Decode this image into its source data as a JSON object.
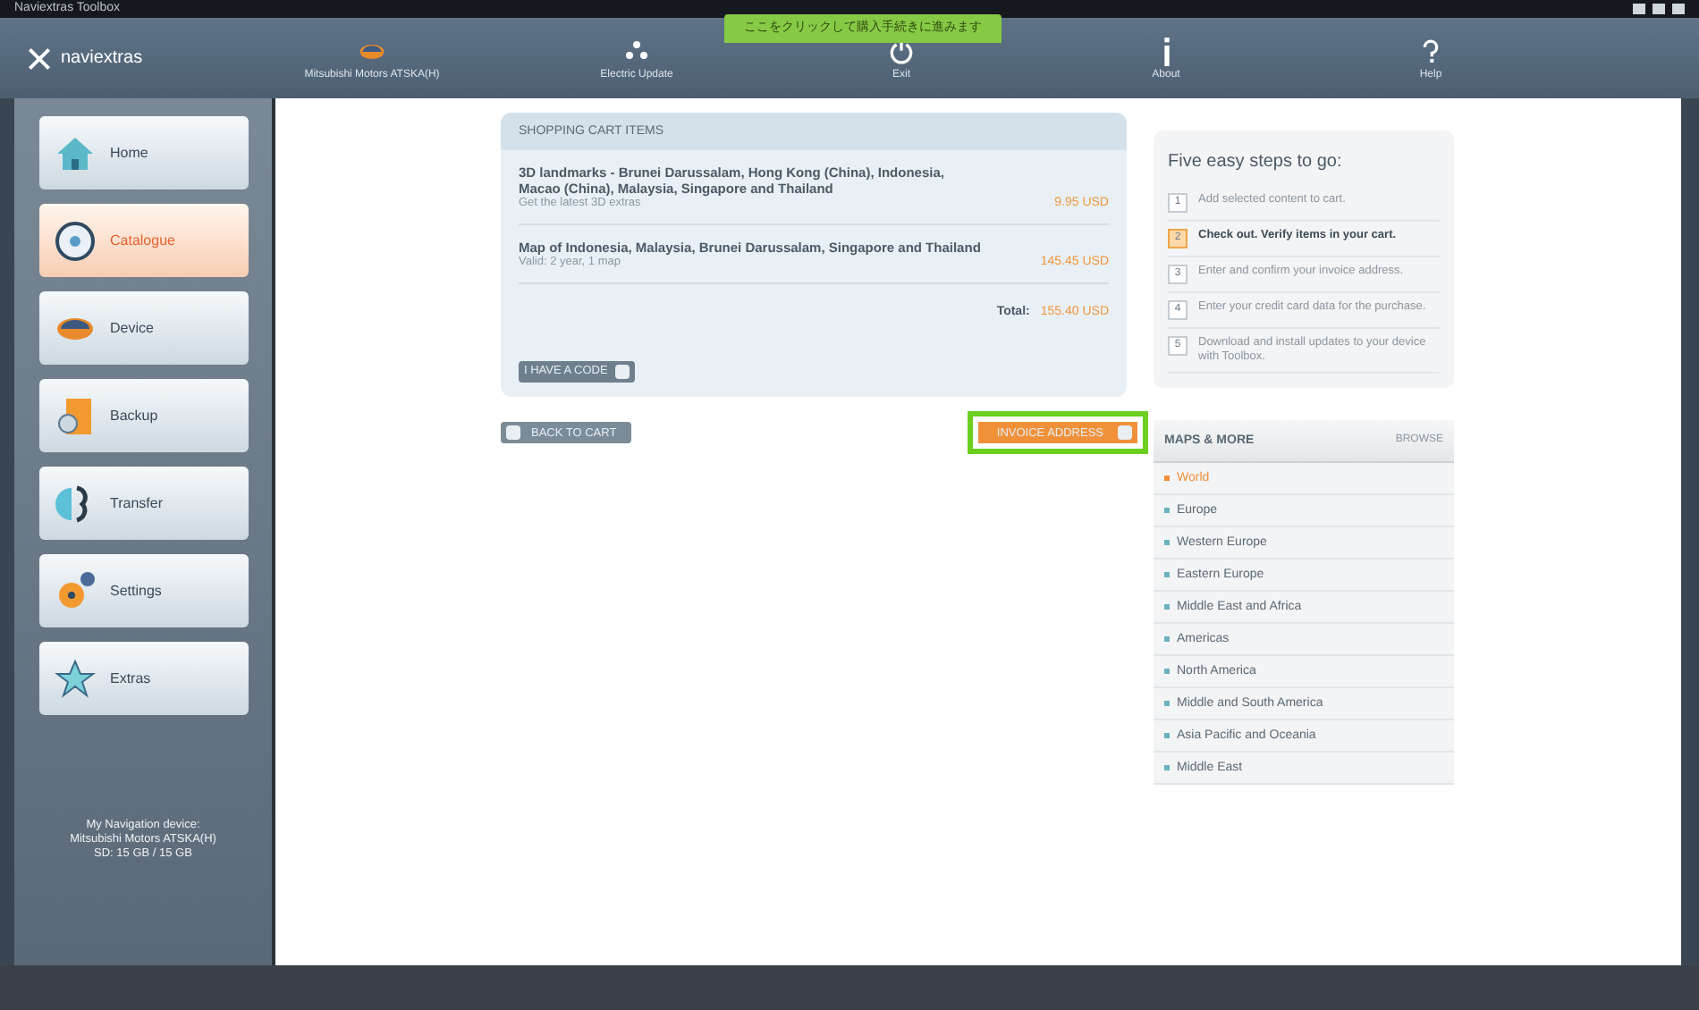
{
  "window": {
    "title": "Naviextras Toolbox"
  },
  "callout": {
    "text": "ここをクリックして購入手続きに進みます"
  },
  "toolbar": {
    "logo": "naviextras",
    "items": [
      {
        "label": "Mitsubishi Motors ATSKA(H)"
      },
      {
        "label": "Electric Update"
      },
      {
        "label": "Exit"
      },
      {
        "label": "About"
      },
      {
        "label": "Help"
      }
    ]
  },
  "sidebar": {
    "items": [
      {
        "label": "Home",
        "selected": false
      },
      {
        "label": "Catalogue",
        "selected": true
      },
      {
        "label": "Device",
        "selected": false
      },
      {
        "label": "Backup",
        "selected": false
      },
      {
        "label": "Transfer",
        "selected": false
      },
      {
        "label": "Settings",
        "selected": false
      },
      {
        "label": "Extras",
        "selected": false
      }
    ],
    "device_info": [
      "My Navigation device:",
      "Mitsubishi Motors ATSKA(H)",
      "SD: 15 GB / 15 GB"
    ]
  },
  "cart": {
    "title": "SHOPPING CART ITEMS",
    "items": [
      {
        "name": "3D landmarks - Brunei Darussalam, Hong Kong (China), Indonesia, Macao (China), Malaysia, Singapore and Thailand",
        "note": "Get the latest 3D extras",
        "price": "9.95 USD"
      },
      {
        "name": "Map of Indonesia, Malaysia, Brunei Darussalam, Singapore and Thailand",
        "note": "Valid: 2 year, 1 map",
        "price": "145.45 USD"
      }
    ],
    "total_label": "Total:",
    "total": "155.40 USD",
    "code_button": "I HAVE A CODE"
  },
  "back_button": "BACK TO CART",
  "next_button": "INVOICE ADDRESS",
  "steps": {
    "title": "Five easy steps to go:",
    "items": [
      {
        "number": "1",
        "text": "Add selected content to cart.",
        "selected": false
      },
      {
        "number": "2",
        "text": "Check out. Verify items in your cart.",
        "selected": true
      },
      {
        "number": "3",
        "text": "Enter and confirm your invoice address.",
        "selected": false
      },
      {
        "number": "4",
        "text": "Enter your credit card data for the purchase.",
        "selected": false
      },
      {
        "number": "5",
        "text": "Download and install updates to your device with Toolbox.",
        "selected": false
      }
    ]
  },
  "maps": {
    "title": "MAPS & MORE",
    "link": "BROWSE",
    "items": [
      {
        "label": "World",
        "selected": true
      },
      {
        "label": "Europe",
        "selected": false
      },
      {
        "label": "Western Europe",
        "selected": false
      },
      {
        "label": "Eastern Europe",
        "selected": false
      },
      {
        "label": "Middle East and Africa",
        "selected": false
      },
      {
        "label": "Americas",
        "selected": false
      },
      {
        "label": "North America",
        "selected": false
      },
      {
        "label": "Middle and South America",
        "selected": false
      },
      {
        "label": "Asia Pacific and Oceania",
        "selected": false
      },
      {
        "label": "Middle East",
        "selected": false
      }
    ]
  }
}
